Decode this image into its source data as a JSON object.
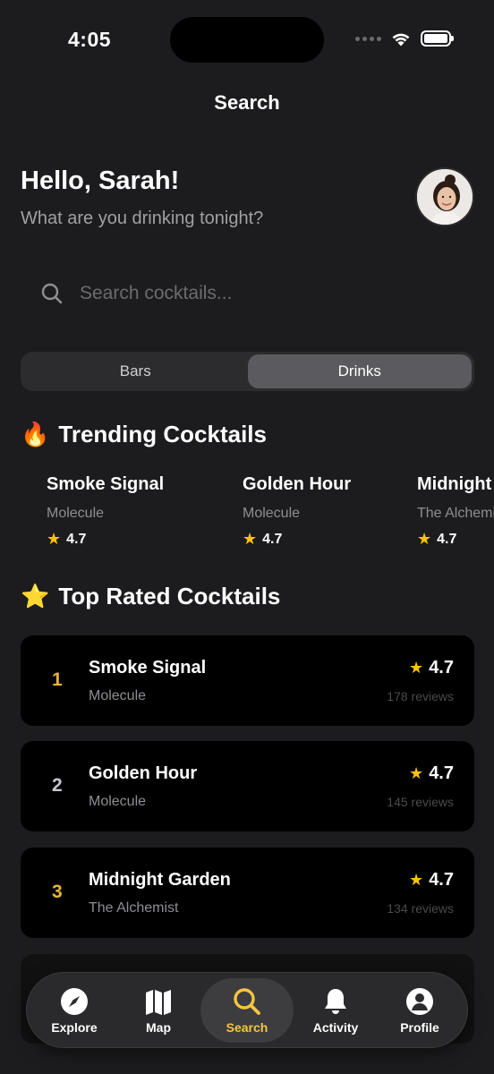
{
  "status": {
    "time": "4:05"
  },
  "nav": {
    "title": "Search"
  },
  "header": {
    "greeting": "Hello, Sarah!",
    "subtitle": "What are you drinking tonight?"
  },
  "search": {
    "placeholder": "Search cocktails..."
  },
  "segments": [
    {
      "label": "Bars",
      "active": false
    },
    {
      "label": "Drinks",
      "active": true
    }
  ],
  "trending": {
    "emoji": "🔥",
    "title": "Trending Cocktails",
    "items": [
      {
        "name": "Smoke Signal",
        "place": "Molecule",
        "rating": "4.7"
      },
      {
        "name": "Golden Hour",
        "place": "Molecule",
        "rating": "4.7"
      },
      {
        "name": "Midnight Garden",
        "place": "The Alchemist",
        "rating": "4.7"
      }
    ]
  },
  "top_rated": {
    "emoji": "⭐",
    "title": "Top Rated Cocktails",
    "items": [
      {
        "rank": "1",
        "name": "Smoke Signal",
        "place": "Molecule",
        "rating": "4.7",
        "reviews": "178 reviews",
        "rank_color": "#e5b43a"
      },
      {
        "rank": "2",
        "name": "Golden Hour",
        "place": "Molecule",
        "rating": "4.7",
        "reviews": "145 reviews",
        "rank_color": "#c7c7cc"
      },
      {
        "rank": "3",
        "name": "Midnight Garden",
        "place": "The Alchemist",
        "rating": "4.7",
        "reviews": "134 reviews",
        "rank_color": "#e5b43a"
      }
    ]
  },
  "tabs": [
    {
      "label": "Explore",
      "icon": "compass-icon"
    },
    {
      "label": "Map",
      "icon": "map-icon"
    },
    {
      "label": "Search",
      "icon": "search-icon",
      "active": true
    },
    {
      "label": "Activity",
      "icon": "bell-icon"
    },
    {
      "label": "Profile",
      "icon": "profile-icon"
    }
  ],
  "colors": {
    "accent": "#f5c542",
    "star": "#ffc20e",
    "background": "#1c1c1e",
    "card": "#000000"
  }
}
